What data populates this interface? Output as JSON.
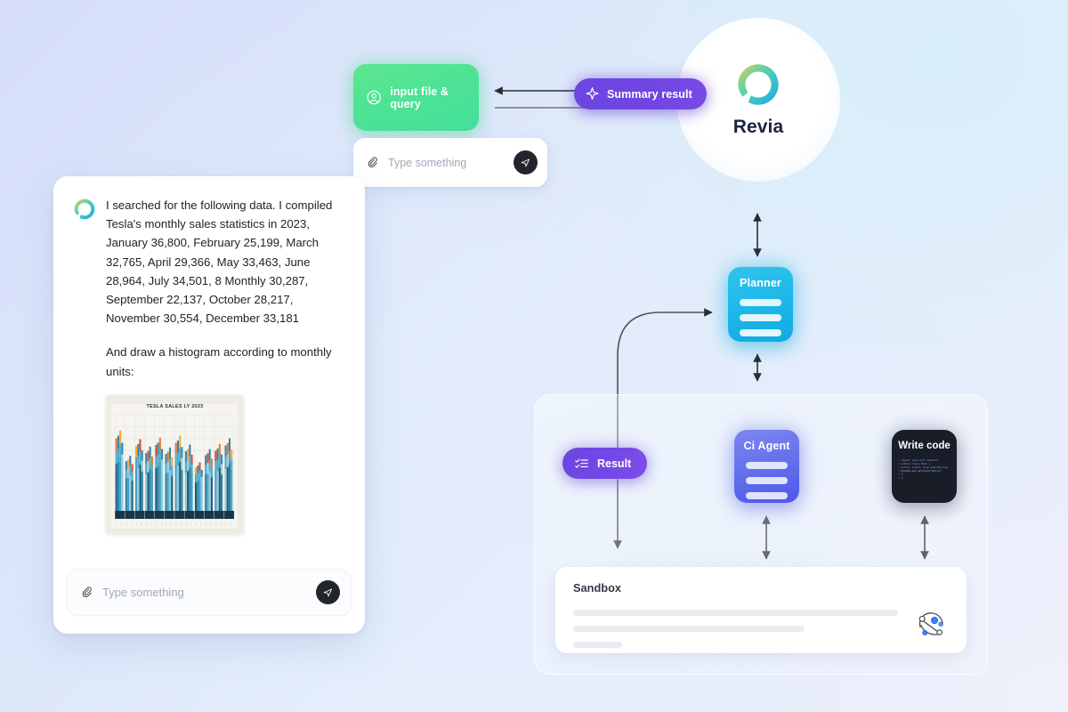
{
  "brand": {
    "name": "Revia",
    "logo_icon": "revia-logo-icon"
  },
  "flow": {
    "input_node": {
      "label": "input file & query",
      "icon": "user-circle-icon",
      "color": "#4fe394"
    },
    "summary_node": {
      "label": "Summary result",
      "icon": "sparkle-icon",
      "color": "#6f45e2"
    },
    "planner_node": {
      "label": "Planner",
      "color": "#1fb9ea"
    },
    "ci_agent_node": {
      "label": "Ci Agent",
      "color": "#6470ec"
    },
    "write_code_node": {
      "label": "Write code",
      "color": "#181d28",
      "code_lines": [
        {
          "n": "1",
          "parts": [
            {
              "t": "import ",
              "c": "kw"
            },
            {
              "t": "java.util.Scanner;",
              "c": "id"
            }
          ]
        },
        {
          "n": "2",
          "parts": [
            {
              "t": "public class ",
              "c": "kw"
            },
            {
              "t": "Main {",
              "c": "id"
            }
          ]
        },
        {
          "n": "3",
          "parts": [
            {
              "t": "  public static void ",
              "c": "kw"
            },
            {
              "t": "main(String",
              "c": "id"
            }
          ]
        },
        {
          "n": "4",
          "parts": [
            {
              "t": "    System.out.println(",
              "c": "pl"
            },
            {
              "t": "\"Hello\"",
              "c": "st"
            }
          ]
        },
        {
          "n": "5",
          "parts": [
            {
              "t": "  }",
              "c": "pl"
            }
          ]
        },
        {
          "n": "6",
          "parts": [
            {
              "t": "}",
              "c": "pl"
            }
          ]
        }
      ]
    },
    "result_node": {
      "label": "Result",
      "icon": "checklist-icon",
      "color": "#7248e6"
    }
  },
  "sandbox": {
    "title": "Sandbox",
    "network_icon": "network-graph-icon",
    "placeholder_rows": 3
  },
  "top_input": {
    "placeholder": "Type something",
    "attachment_icon": "paperclip-icon",
    "send_icon": "send-icon",
    "value": ""
  },
  "chat": {
    "avatar_icon": "revia-avatar-icon",
    "message_paragraph_1": "I searched for the following data. I compiled Tesla's monthly sales statistics in 2023, January 36,800, February 25,199, March 32,765, April 29,366, May 33,463, June 28,964, July 34,501, 8 Monthly 30,287, September 22,137, October 28,217, November 30,554, December 33,181",
    "message_paragraph_2": "And draw a histogram according to monthly units:",
    "input": {
      "placeholder": "Type something",
      "attachment_icon": "paperclip-icon",
      "send_icon": "send-icon",
      "value": ""
    }
  },
  "chart_data": {
    "type": "bar",
    "title": "TESLA SALES LY 2023",
    "xlabel": "",
    "ylabel": "",
    "categories": [
      "January",
      "February",
      "March",
      "April",
      "May",
      "June",
      "July",
      "8 Monthly",
      "September",
      "October",
      "November",
      "December"
    ],
    "values": [
      36800,
      25199,
      32765,
      29366,
      33463,
      28964,
      34501,
      30287,
      22137,
      28217,
      30554,
      33181
    ],
    "ylim": [
      0,
      40000
    ],
    "grid": true,
    "legend": "none",
    "palette": [
      "#1b5a7a",
      "#2a7fa3",
      "#3da3c4",
      "#8fc9dc",
      "#e8743b",
      "#d94f33",
      "#f4a83a",
      "#0e3d55"
    ]
  }
}
